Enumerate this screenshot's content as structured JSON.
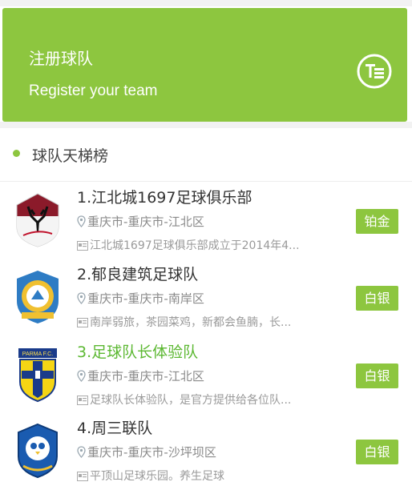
{
  "header": {
    "title_zh": "注册球队",
    "title_en": "Register your team"
  },
  "section": {
    "title": "球队天梯榜"
  },
  "teams": [
    {
      "name": "1.江北城1697足球俱乐部",
      "location": "重庆市-重庆市-江北区",
      "description": "江北城1697足球俱乐部成立于2014年4...",
      "badge": "铂金"
    },
    {
      "name": "2.郁良建筑足球队",
      "location": "重庆市-重庆市-南岸区",
      "description": "南岸弱旅，茶园菜鸡，新都会鱼腩，长...",
      "badge": "白银"
    },
    {
      "name": "3.足球队长体验队",
      "location": "重庆市-重庆市-江北区",
      "description": "足球队长体验队，是官方提供给各位队...",
      "badge": "白银",
      "logo_text": "PARMA F.C."
    },
    {
      "name": "4.周三联队",
      "location": "重庆市-重庆市-沙坪坝区",
      "description": "平顶山足球乐园。养生足球",
      "badge": "白银"
    }
  ],
  "colors": {
    "accent": "#8dc63f",
    "active_name": "#5cb832"
  }
}
